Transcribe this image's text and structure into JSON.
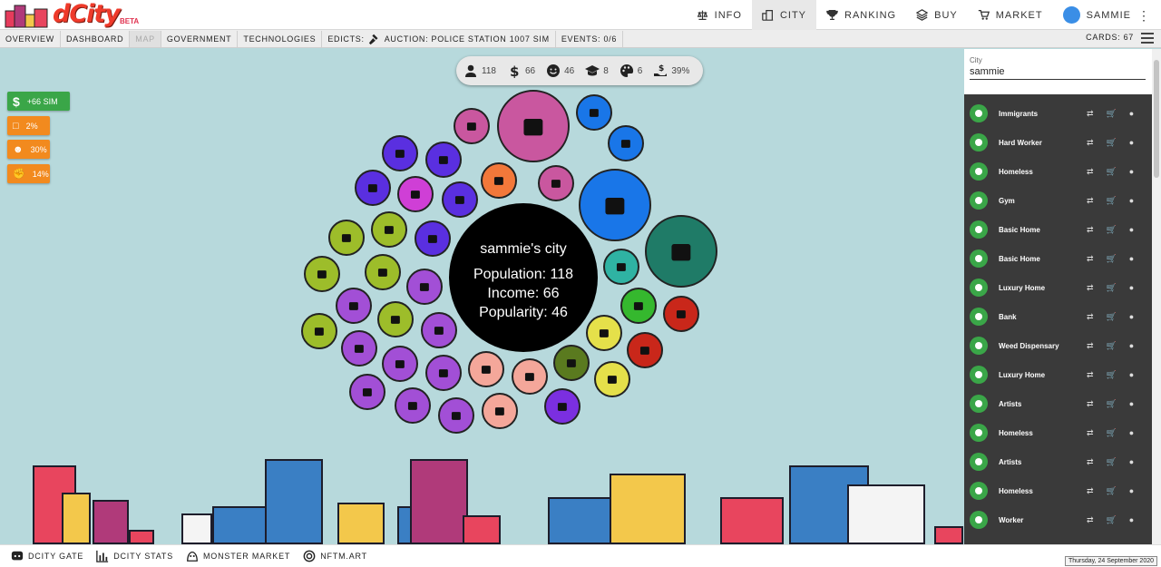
{
  "app": {
    "logo_text": "dCity",
    "logo_badge": "BETA"
  },
  "nav": {
    "items": [
      {
        "label": "INFO",
        "icon": "scale-icon"
      },
      {
        "label": "CITY",
        "icon": "city-icon",
        "active": true
      },
      {
        "label": "RANKING",
        "icon": "trophy-icon"
      },
      {
        "label": "BUY",
        "icon": "layers-icon"
      },
      {
        "label": "MARKET",
        "icon": "cart-icon"
      },
      {
        "label": "SAMMIE",
        "icon": "avatar"
      }
    ]
  },
  "subnav": {
    "items": [
      "OVERVIEW",
      "DASHBOARD",
      "MAP",
      "GOVERNMENT",
      "TECHNOLOGIES"
    ],
    "edicts_label": "EDICTS:",
    "auction_label": "AUCTION: POLICE STATION 1007 SIM",
    "events_label": "EVENTS: 0/6",
    "cards_label": "CARDS: 67"
  },
  "stats": [
    {
      "icon": "person-icon",
      "value": "118"
    },
    {
      "icon": "dollar-icon",
      "value": "66"
    },
    {
      "icon": "smile-icon",
      "value": "46"
    },
    {
      "icon": "graduation-icon",
      "value": "8"
    },
    {
      "icon": "palette-icon",
      "value": "6"
    },
    {
      "icon": "tax-hand-icon",
      "value": "39%"
    }
  ],
  "badges": [
    {
      "label": "+66 SIM",
      "color": "#3aa648",
      "icon": "dollar-icon"
    },
    {
      "label": "2%",
      "color": "#f28a1e",
      "icon": "building-icon"
    },
    {
      "label": "30%",
      "color": "#f28a1e",
      "icon": "worker-icon"
    },
    {
      "label": "14%",
      "color": "#f28a1e",
      "icon": "fist-icon"
    }
  ],
  "city": {
    "name": "sammie's city",
    "population": "Population: 118",
    "income": "Income: 66",
    "popularity": "Popularity: 46"
  },
  "sidebar": {
    "city_label": "City",
    "city_value": "sammie",
    "items": [
      "Immigrants",
      "Hard Worker",
      "Homeless",
      "Gym",
      "Basic Home",
      "Basic Home",
      "Luxury Home",
      "Bank",
      "Weed Dispensary",
      "Luxury Home",
      "Artists",
      "Homeless",
      "Artists",
      "Homeless",
      "Worker"
    ]
  },
  "footer": {
    "items": [
      {
        "label": "DCITY GATE",
        "icon": "discord-icon"
      },
      {
        "label": "DCITY STATS",
        "icon": "bar-chart-icon"
      },
      {
        "label": "MONSTER MARKET",
        "icon": "monster-icon"
      },
      {
        "label": "NFTM.ART",
        "icon": "target-icon"
      }
    ],
    "date": "Thursday, 24 September 2020"
  },
  "colors": {
    "sky": "#b7d9dc",
    "sidebar": "#3a3a3a",
    "accent_green": "#3aa648",
    "accent_orange": "#f28a1e"
  }
}
